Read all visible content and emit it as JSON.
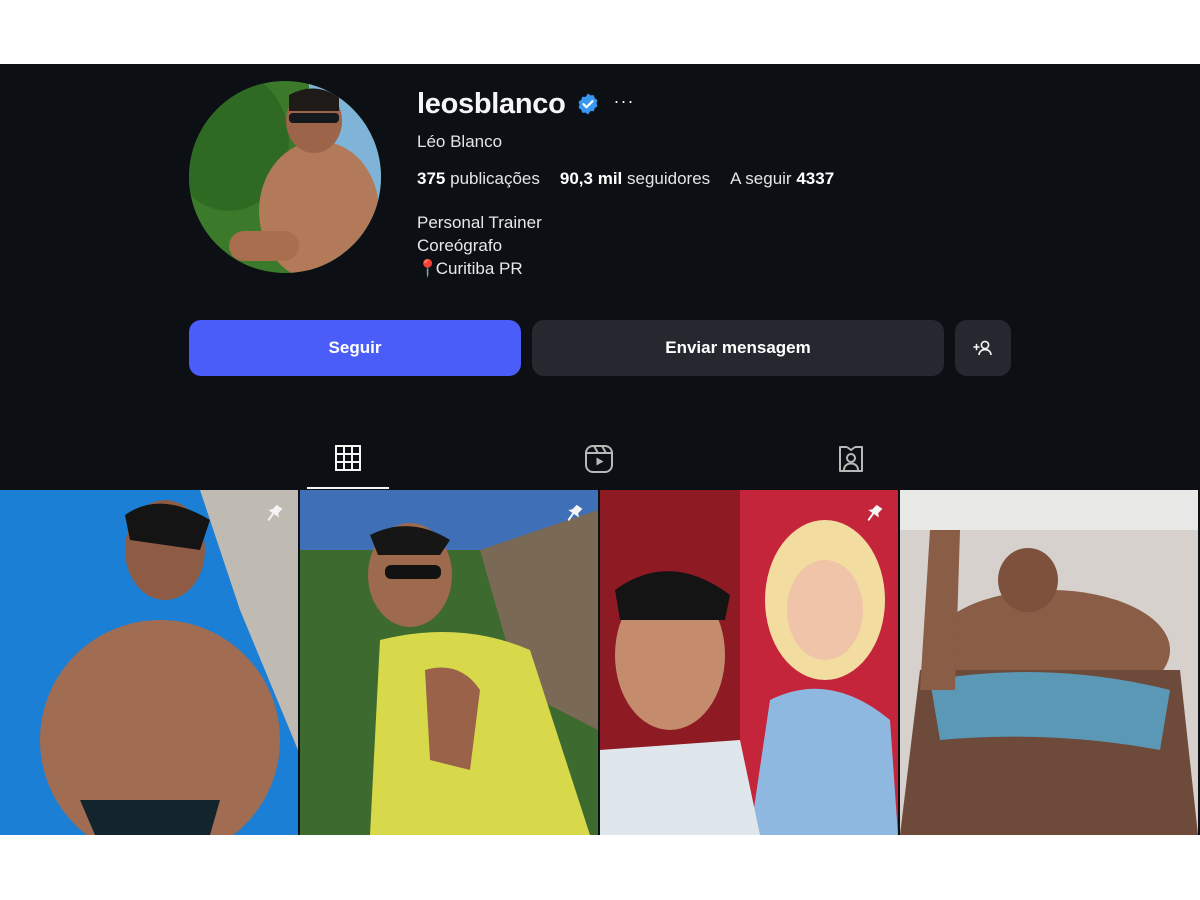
{
  "profile": {
    "username": "leosblanco",
    "verified_icon": "verified-badge-icon",
    "more_label": "···",
    "full_name": "Léo Blanco",
    "stats": {
      "posts_count": "375",
      "posts_label": "publicações",
      "followers_count": "90,3 mil",
      "followers_label": "seguidores",
      "following_label": "A seguir",
      "following_count": "4337"
    },
    "bio": {
      "line1": "Personal Trainer",
      "line2": "Coreógrafo",
      "location_pin": "📍",
      "line3": "Curitiba PR"
    }
  },
  "actions": {
    "follow_label": "Seguir",
    "message_label": "Enviar mensagem",
    "suggest_icon": "add-person-icon"
  },
  "tabs": [
    {
      "icon": "grid-icon",
      "active": true
    },
    {
      "icon": "reels-icon",
      "active": false
    },
    {
      "icon": "tagged-icon",
      "active": false
    }
  ],
  "posts": [
    {
      "pinned": true,
      "icon": "pin-icon"
    },
    {
      "pinned": true,
      "icon": "pin-icon"
    },
    {
      "pinned": true,
      "icon": "pin-icon"
    },
    {
      "pinned": false
    }
  ],
  "colors": {
    "background": "#0c0f14",
    "follow_button": "#4a5df9",
    "secondary_button": "#25282e",
    "verified": "#3897f0"
  }
}
